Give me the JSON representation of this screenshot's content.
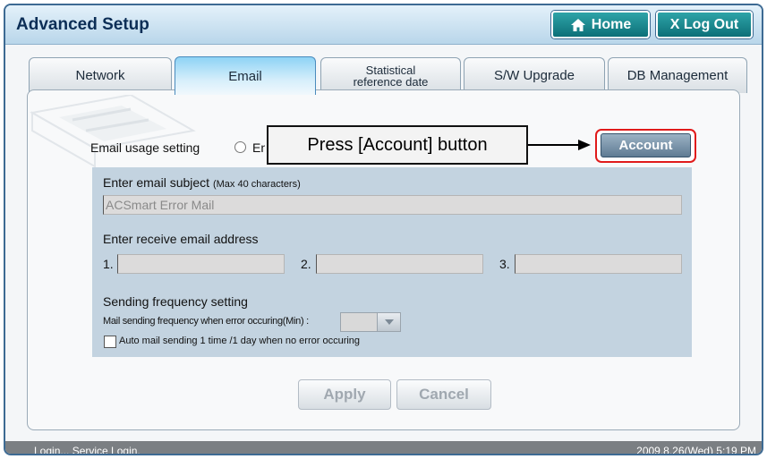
{
  "title": "Advanced Setup",
  "header": {
    "home_label": "Home",
    "logout_label": "X Log Out"
  },
  "tabs": [
    {
      "label": "Network",
      "active": false
    },
    {
      "label": "Email",
      "active": true
    },
    {
      "label_line1": "Statistical",
      "label_line2": "reference date",
      "active": false
    },
    {
      "label": "S/W Upgrade",
      "active": false
    },
    {
      "label": "DB Management",
      "active": false
    }
  ],
  "email": {
    "usage_label": "Email usage setting",
    "radio_label": "En",
    "account_label": "Account",
    "callout_text": "Press [Account] button",
    "subject_label": "Enter email subject",
    "subject_hint": "(Max 40 characters)",
    "subject_value": "ACSmart Error Mail",
    "address_label": "Enter receive email address",
    "address_nums": [
      "1.",
      "2.",
      "3."
    ],
    "addresses": [
      "",
      "",
      ""
    ],
    "frequency_label": "Sending frequency setting",
    "frequency_desc": "Mail sending frequency when error occuring(Min) :",
    "frequency_value": "",
    "auto_mail_label": "Auto mail sending 1 time /1 day when no error occuring",
    "auto_mail_checked": false
  },
  "buttons": {
    "apply": "Apply",
    "cancel": "Cancel"
  },
  "status": {
    "left": "Login... Service Login.",
    "right": "2009.8.26(Wed) 5:19 PM"
  },
  "colors": {
    "title_bar": "#b9d6ea",
    "header_button": "#0d6f78",
    "highlight": "#e01b1b",
    "settings_panel": "#c3d3e0"
  }
}
